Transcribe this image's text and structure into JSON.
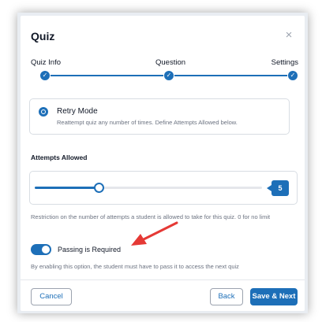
{
  "modal": {
    "title": "Quiz",
    "close_glyph": "×"
  },
  "steps": [
    {
      "label": "Quiz Info",
      "completed": true
    },
    {
      "label": "Question",
      "completed": true
    },
    {
      "label": "Settings",
      "completed": true
    }
  ],
  "retry_mode": {
    "title": "Retry Mode",
    "description": "Reattempt quiz any number of times. Define Attempts Allowed below.",
    "selected": true
  },
  "attempts": {
    "label": "Attempts Allowed",
    "value": "5",
    "slider_fraction": 0.28,
    "help": "Restriction on the number of attempts a student is allowed to take for this quiz. 0 for no limit"
  },
  "passing": {
    "label": "Passing is Required",
    "enabled": true,
    "description": "By enabling this option, the student must have to pass it to access the next quiz"
  },
  "footer": {
    "cancel": "Cancel",
    "back": "Back",
    "next": "Save & Next"
  },
  "colors": {
    "accent": "#1d6fb8",
    "annotation_arrow": "#e53935"
  }
}
